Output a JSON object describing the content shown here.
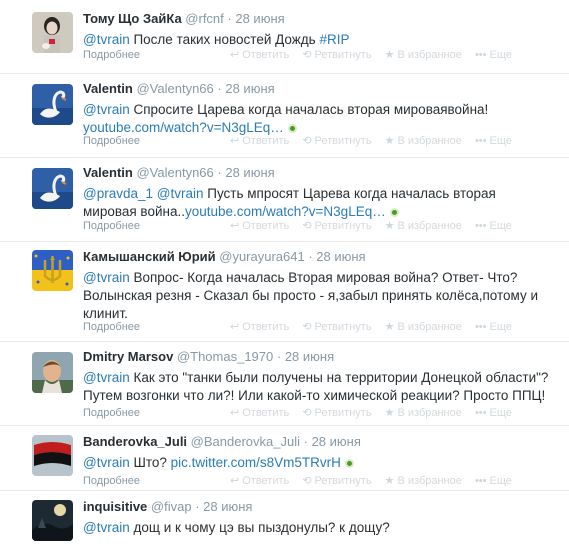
{
  "tweets": [
    {
      "fullname": "Тому Що ЗайКа",
      "username": "@rfcnf",
      "time": "28 июня",
      "segments": [
        {
          "type": "mention",
          "text": "@tvrain"
        },
        {
          "type": "text",
          "text": " После таких новостей Дождь "
        },
        {
          "type": "hashtag",
          "text": "#RIP"
        }
      ],
      "has_media": false,
      "avatar": "girl-with-dog"
    },
    {
      "fullname": "Valentin",
      "username": "@Valentyn66",
      "time": "28 июня",
      "segments": [
        {
          "type": "mention",
          "text": "@tvrain"
        },
        {
          "type": "text",
          "text": " Спросите Царева когда началась вторая мироваявойна! "
        },
        {
          "type": "link",
          "text": "youtube.com/watch?v=N3gLEq…"
        }
      ],
      "has_media": true,
      "avatar": "swan"
    },
    {
      "fullname": "Valentin",
      "username": "@Valentyn66",
      "time": "28 июня",
      "segments": [
        {
          "type": "mention",
          "text": "@pravda_1"
        },
        {
          "type": "text",
          "text": " "
        },
        {
          "type": "mention",
          "text": "@tvrain"
        },
        {
          "type": "text",
          "text": " Пусть мпросят Царева когда началась вторая мировая война.."
        },
        {
          "type": "link",
          "text": "youtube.com/watch?v=N3gLEq…"
        }
      ],
      "has_media": true,
      "avatar": "swan"
    },
    {
      "fullname": "Камышанский Юрий",
      "username": "@yurayura641",
      "time": "28 июня",
      "segments": [
        {
          "type": "mention",
          "text": "@tvrain"
        },
        {
          "type": "text",
          "text": " Вопрос- Когда началась Вторая мировая война? Ответ- Что? Волынская резня - Сказал бы просто - я,забыл принять колёса,потому и клинит."
        }
      ],
      "has_media": false,
      "avatar": "flag-trident"
    },
    {
      "fullname": "Dmitry Marsov",
      "username": "@Thomas_1970",
      "time": "28 июня",
      "segments": [
        {
          "type": "mention",
          "text": "@tvrain"
        },
        {
          "type": "text",
          "text": " Как это \"танки были получены на территории Донецкой области\"? Путем возгонки что ли?! Или какой-то химической реакции? Просто ППЦ!"
        }
      ],
      "has_media": false,
      "avatar": "man-photo"
    },
    {
      "fullname": "Banderovka_Juli",
      "username": "@Banderovka_Juli",
      "time": "28 июня",
      "segments": [
        {
          "type": "mention",
          "text": "@tvrain"
        },
        {
          "type": "text",
          "text": " Што? "
        },
        {
          "type": "link",
          "text": "pic.twitter.com/s8Vm5TRvrH"
        }
      ],
      "has_media": true,
      "avatar": "red-black-flag"
    },
    {
      "fullname": "inquisitive",
      "username": "@fivap",
      "time": "28 июня",
      "segments": [
        {
          "type": "mention",
          "text": "@tvrain"
        },
        {
          "type": "text",
          "text": " дощ и к чому  цэ вы пыздонулы? к дощу?"
        }
      ],
      "has_media": false,
      "avatar": "dark-scene"
    }
  ],
  "footer": {
    "expand": "Подробнее",
    "reply": "Ответить",
    "retweet": "Ретвитнуть",
    "favorite": "В избранное",
    "more": "Еще"
  },
  "colors": {
    "link": "#2a7cb8",
    "meta": "#8899a6",
    "action": "#d4d9dd",
    "media_dot": "#4a9a25"
  }
}
